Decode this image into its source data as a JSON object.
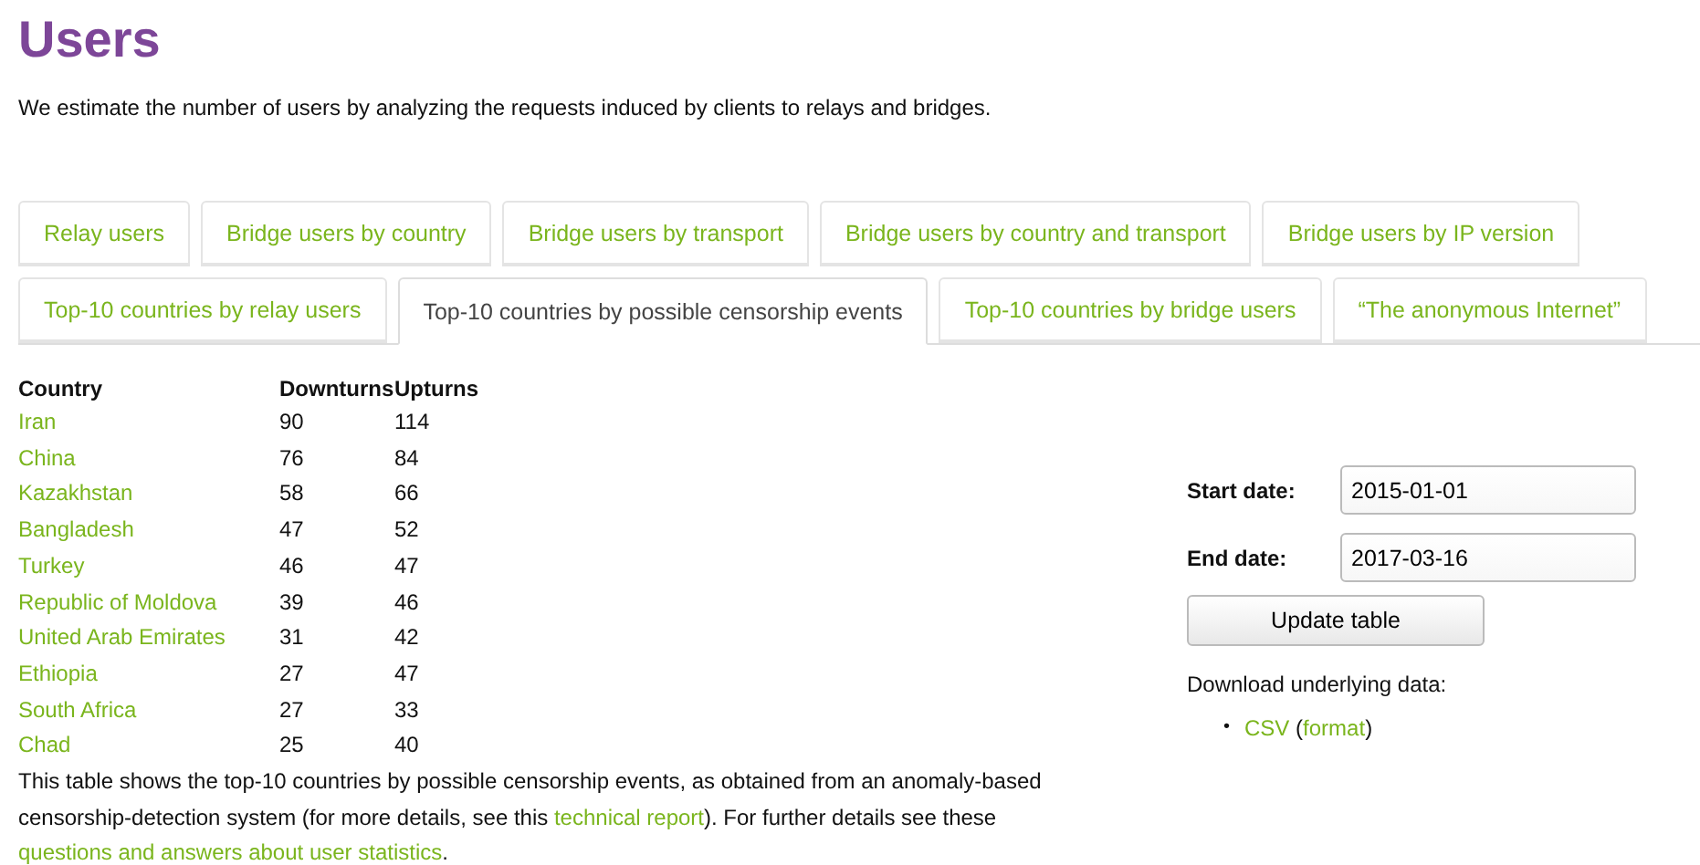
{
  "title": "Users",
  "intro": "We estimate the number of users by analyzing the requests induced by clients to relays and bridges.",
  "tab_rows": [
    [
      {
        "label": "Relay users",
        "selected": false
      },
      {
        "label": "Bridge users by country",
        "selected": false
      },
      {
        "label": "Bridge users by transport",
        "selected": false
      },
      {
        "label": "Bridge users by country and transport",
        "selected": false
      },
      {
        "label": "Bridge users by IP version",
        "selected": false
      }
    ],
    [
      {
        "label": "Top-10 countries by relay users",
        "selected": false
      },
      {
        "label": "Top-10 countries by possible censorship events",
        "selected": true
      },
      {
        "label": "Top-10 countries by bridge users",
        "selected": false
      },
      {
        "label": "“The anonymous Internet”",
        "selected": false
      }
    ]
  ],
  "table": {
    "columns": [
      "Country",
      "Downturns",
      "Upturns"
    ],
    "rows": [
      [
        "Iran",
        "90",
        "114"
      ],
      [
        "China",
        "76",
        "84"
      ],
      [
        "Kazakhstan",
        "58",
        "66"
      ],
      [
        "Bangladesh",
        "47",
        "52"
      ],
      [
        "Turkey",
        "46",
        "47"
      ],
      [
        "Republic of Moldova",
        "39",
        "46"
      ],
      [
        "United Arab Emirates",
        "31",
        "42"
      ],
      [
        "Ethiopia",
        "27",
        "47"
      ],
      [
        "South Africa",
        "27",
        "33"
      ],
      [
        "Chad",
        "25",
        "40"
      ]
    ]
  },
  "note": [
    {
      "kind": "text",
      "text": "This table shows the top-10 countries by possible censorship events, as obtained from an anomaly-based censorship-detection system (for more details, see this "
    },
    {
      "kind": "link",
      "text": "technical report"
    },
    {
      "kind": "text",
      "text": "). For further details see these "
    },
    {
      "kind": "link",
      "text": "questions and answers about user statistics"
    },
    {
      "kind": "text",
      "text": "."
    }
  ],
  "form": {
    "fields": [
      {
        "label": "Start date:",
        "value": "2015-01-01"
      },
      {
        "label": "End date:",
        "value": "2017-03-16"
      }
    ],
    "button": "Update table"
  },
  "download": {
    "heading": "Download underlying data:",
    "bullet": "•",
    "item": [
      {
        "kind": "link",
        "text": "CSV"
      },
      {
        "kind": "text",
        "text": " ("
      },
      {
        "kind": "link",
        "text": "format"
      },
      {
        "kind": "text",
        "text": ")"
      }
    ]
  }
}
